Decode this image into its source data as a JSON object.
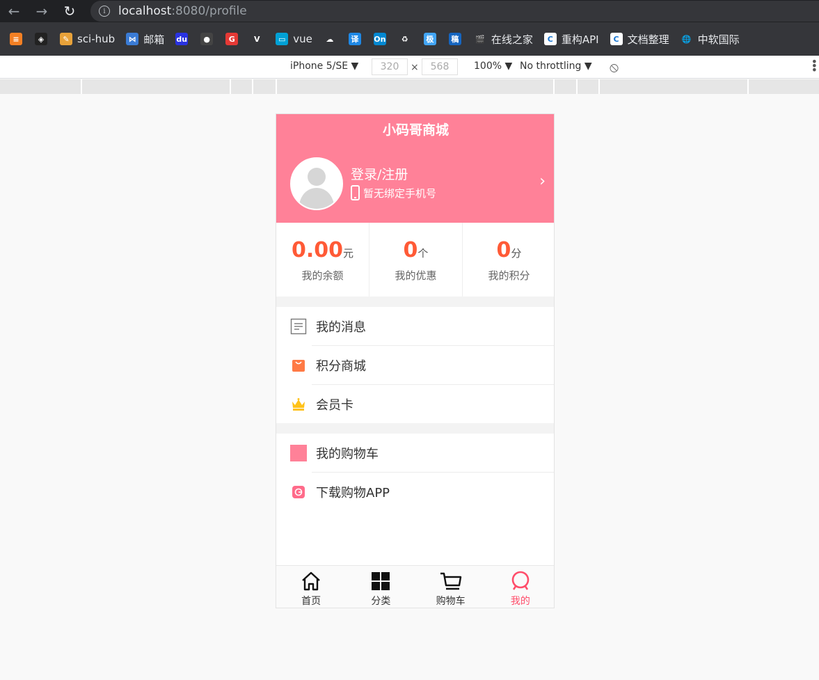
{
  "browser": {
    "url_host": "localhost",
    "url_path": ":8080/profile",
    "back_glyph": "←",
    "forward_glyph": "→",
    "reload_glyph": "↻",
    "info_glyph": "i",
    "bookmarks": [
      {
        "label": "",
        "icon": "stack-icon",
        "color": "#f48024",
        "glyph": "≡"
      },
      {
        "label": "",
        "icon": "arrow-logo-icon",
        "color": "#222",
        "glyph": "◈"
      },
      {
        "label": "sci-hub",
        "icon": "sci-hub-icon",
        "color": "#e8a23a",
        "glyph": "✎"
      },
      {
        "label": "邮箱",
        "icon": "mail-icon",
        "color": "#3a7bd5",
        "glyph": "⋈"
      },
      {
        "label": "",
        "icon": "baidu-icon",
        "color": "#2932e1",
        "glyph": "du"
      },
      {
        "label": "",
        "icon": "github-icon",
        "color": "#444",
        "glyph": "●"
      },
      {
        "label": "",
        "icon": "g-icon",
        "color": "#e53935",
        "glyph": "G"
      },
      {
        "label": "",
        "icon": "vue-logo-icon",
        "color": "#35363a",
        "glyph": "V"
      },
      {
        "label": "vue",
        "icon": "bilibili-icon",
        "color": "#00a1d6",
        "glyph": "▭"
      },
      {
        "label": "",
        "icon": "cloud-icon",
        "color": "#35363a",
        "glyph": "☁"
      },
      {
        "label": "",
        "icon": "translate-icon",
        "color": "#1e88e5",
        "glyph": "译"
      },
      {
        "label": "",
        "icon": "on-icon",
        "color": "#0288d1",
        "glyph": "On"
      },
      {
        "label": "",
        "icon": "recycle-icon",
        "color": "#35363a",
        "glyph": "♻"
      },
      {
        "label": "",
        "icon": "ji-icon",
        "color": "#42a5f5",
        "glyph": "极"
      },
      {
        "label": "",
        "icon": "gao-icon",
        "color": "#1565c0",
        "glyph": "稿"
      },
      {
        "label": "在线之家",
        "icon": "clapper-icon",
        "color": "#35363a",
        "glyph": "🎬"
      },
      {
        "label": "重构API",
        "icon": "c-doc-icon",
        "color": "#ffffff",
        "glyph": "C"
      },
      {
        "label": "文档整理",
        "icon": "c-doc-icon",
        "color": "#ffffff",
        "glyph": "C"
      },
      {
        "label": "中软国际",
        "icon": "globe-icon",
        "color": "#35363a",
        "glyph": "🌐"
      }
    ]
  },
  "devtools": {
    "device": "iPhone 5/SE ▼",
    "width": "320",
    "times": "×",
    "height": "568",
    "zoom": "100% ▼",
    "throttle": "No throttling ▼",
    "rotate_glyph": "⦸",
    "more_glyph": "⋮"
  },
  "app": {
    "title": "小码哥商城",
    "login_label": "登录/注册",
    "phone_status": "暂无绑定手机号",
    "chevron": "›",
    "stats": [
      {
        "value": "0.00",
        "unit": "元",
        "label": "我的余额"
      },
      {
        "value": "0",
        "unit": "个",
        "label": "我的优惠"
      },
      {
        "value": "0",
        "unit": "分",
        "label": "我的积分"
      }
    ],
    "menu_group1": [
      {
        "label": "我的消息",
        "icon": "message-icon"
      },
      {
        "label": "积分商城",
        "icon": "shopping-bag-icon"
      },
      {
        "label": "会员卡",
        "icon": "crown-icon"
      }
    ],
    "menu_group2": [
      {
        "label": "我的购物车",
        "icon": "cart-square-icon"
      },
      {
        "label": "下载购物APP",
        "icon": "app-download-icon"
      }
    ],
    "tabs": [
      {
        "label": "首页",
        "icon": "home-icon"
      },
      {
        "label": "分类",
        "icon": "category-grid-icon"
      },
      {
        "label": "购物车",
        "icon": "cart-icon"
      },
      {
        "label": "我的",
        "icon": "profile-icon"
      }
    ],
    "colors": {
      "brand_pink": "#ff8198",
      "accent_orange": "#ff5a36",
      "active_tab": "#ff4d6a"
    }
  }
}
